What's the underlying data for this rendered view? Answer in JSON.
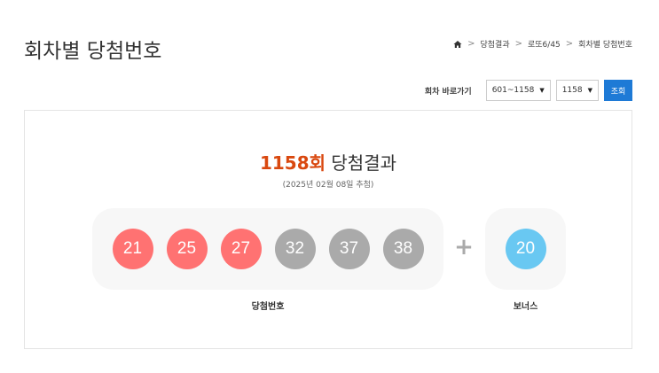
{
  "page": {
    "title": "회차별 당첨번호"
  },
  "breadcrumb": {
    "home_icon": "home-icon",
    "items": [
      "당첨결과",
      "로또6/45",
      "회차별 당첨번호"
    ]
  },
  "toolbar": {
    "label": "회차 바로가기",
    "range_select": "601~1158",
    "round_select": "1158",
    "search_label": "조회"
  },
  "result": {
    "round": "1158회",
    "title_suffix": "당첨결과",
    "date": "(2025년 02월 08일 추첨)",
    "numbers": [
      {
        "value": "21",
        "color": "#ff7272"
      },
      {
        "value": "25",
        "color": "#ff7272"
      },
      {
        "value": "27",
        "color": "#ff7272"
      },
      {
        "value": "32",
        "color": "#aaaaaa"
      },
      {
        "value": "37",
        "color": "#aaaaaa"
      },
      {
        "value": "38",
        "color": "#aaaaaa"
      }
    ],
    "plus": "+",
    "bonus": {
      "value": "20",
      "color": "#69c8f2"
    },
    "main_caption": "당첨번호",
    "bonus_caption": "보너스"
  }
}
